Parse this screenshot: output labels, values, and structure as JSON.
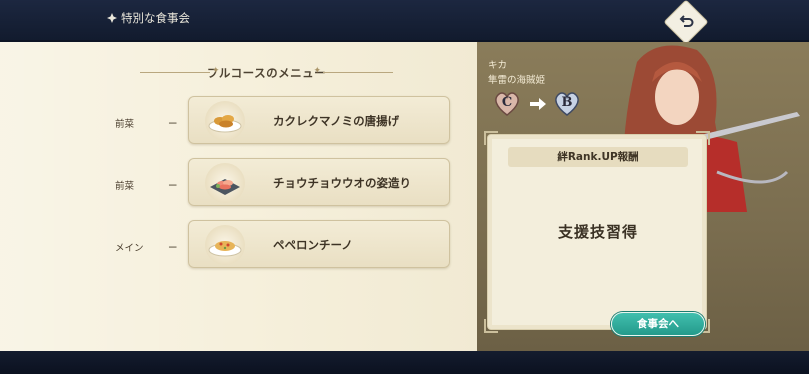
{
  "header": {
    "title": "特別な食事会",
    "back_icon": "back-arrow-icon"
  },
  "menu": {
    "title": "フルコースのメニュー",
    "courses": [
      {
        "course": "前菜",
        "dash": "ー",
        "dish": "カクレクマノミの唐揚げ",
        "icon": "fried-fish-dish-icon"
      },
      {
        "course": "前菜",
        "dash": "ー",
        "dish": "チョウチョウウオの姿造り",
        "icon": "sashimi-plate-icon"
      },
      {
        "course": "メイン",
        "dash": "ー",
        "dish": "ペペロンチーノ",
        "icon": "pasta-plate-icon"
      }
    ]
  },
  "character": {
    "name": "キカ",
    "title": "隼雷の海賊姫",
    "rank_from": "C",
    "rank_to": "B"
  },
  "reward": {
    "header": "絆Rank.UP報酬",
    "text": "支援技習得"
  },
  "actions": {
    "meal_button": "食事会へ"
  },
  "colors": {
    "panel_cream": "#f6f0dc",
    "panel_olive": "#7a6d4f",
    "accent_teal": "#249a8b"
  }
}
